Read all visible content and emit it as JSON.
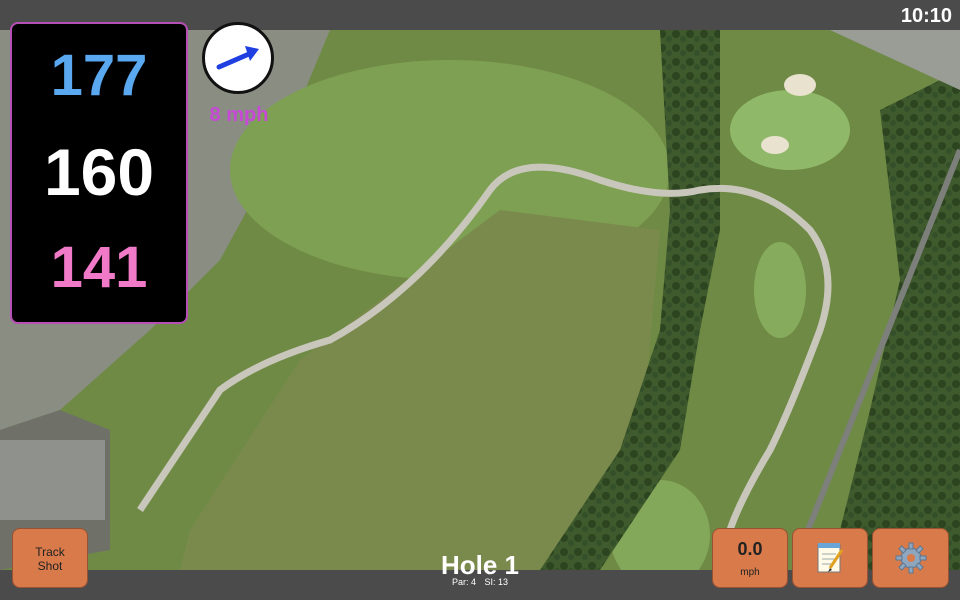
{
  "clock": "10:10",
  "distances": {
    "back": "177",
    "middle": "160",
    "front": "141",
    "colors": {
      "back": "#5aa9f0",
      "middle": "#ffffff",
      "front": "#f07ac8"
    }
  },
  "wind": {
    "speed_label": "8 mph",
    "direction_icon": "arrow-icon",
    "color": "#c74ad6"
  },
  "track_shot": {
    "label": "Track\nShot"
  },
  "hole": {
    "title": "Hole 1",
    "par": "Par: 4",
    "si": "SI: 13"
  },
  "speed": {
    "value": "0.0",
    "unit": "mph"
  },
  "notes": {
    "icon": "notepad-icon"
  },
  "settings": {
    "icon": "gear-icon"
  },
  "theme": {
    "button": "#d87a4a",
    "bar": "#4b4b4b"
  }
}
